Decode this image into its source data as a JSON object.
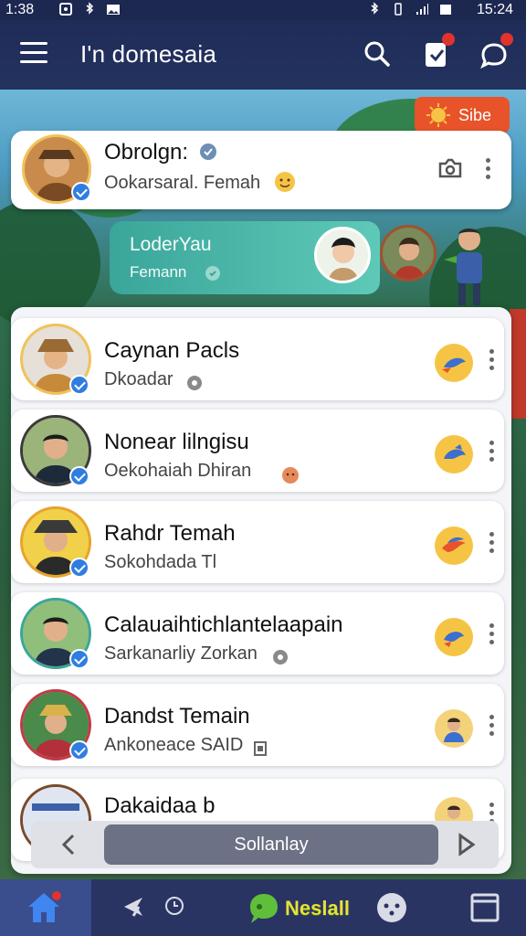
{
  "status_bar": {
    "time_left": "1:38",
    "time_right": "15:24"
  },
  "app_bar": {
    "title": "I'n domesaia"
  },
  "tag_pill": {
    "label": "Sibe"
  },
  "featured": {
    "name": "Obrolgn:",
    "subtitle": "Ookarsaral. Femah"
  },
  "banner": {
    "title": "LoderYau",
    "subtitle": "Femann"
  },
  "contacts": [
    {
      "name": "Caynan Pacls",
      "subtitle": "Dkoadar"
    },
    {
      "name": "Nonear lilngisu",
      "subtitle": "Oekohaiah Dhiran"
    },
    {
      "name": "Rahdr Temah",
      "subtitle": "Sokohdada Tl"
    },
    {
      "name": "Calauaihtichlantelaapain",
      "subtitle": "Sarkanarliy Zorkan"
    },
    {
      "name": "Dandst Temain",
      "subtitle": "Ankoneace SAID"
    },
    {
      "name": "Dakaidaa b",
      "subtitle": ""
    }
  ],
  "pager": {
    "center_label": "Sollanlay"
  },
  "bottom_nav": {
    "brand_label": "Neslall"
  },
  "colors": {
    "appbar": "#1f2c58",
    "accent": "#2f7de1",
    "reaction": "#f6c444",
    "banner": "#3aa69a",
    "tag": "#e8532a"
  }
}
